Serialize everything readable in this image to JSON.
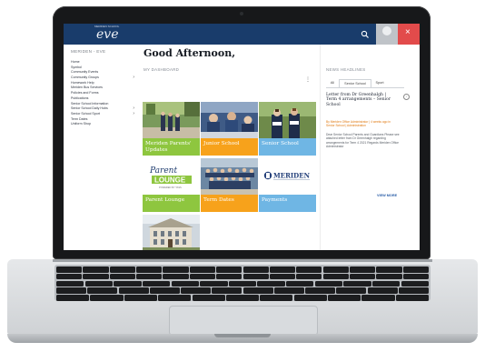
{
  "app": {
    "brand_small": "MERIDEN SCHOOL",
    "brand": "eve",
    "close_label": "×"
  },
  "sidebar": {
    "title": "MERIDEN - EVE",
    "items": [
      {
        "label": "Home",
        "has_submenu": false
      },
      {
        "label": "Symbol",
        "has_submenu": false
      },
      {
        "label": "Community Events",
        "has_submenu": false
      },
      {
        "label": "Community Groups",
        "has_submenu": true
      },
      {
        "label": "Homework Help",
        "has_submenu": false
      },
      {
        "label": "Meriden Bus Services",
        "has_submenu": false
      },
      {
        "label": "Policies and Forms",
        "has_submenu": false
      },
      {
        "label": "Publications",
        "has_submenu": false
      },
      {
        "label": "Senior School Information",
        "has_submenu": false
      },
      {
        "label": "Senior School Daily Hubs",
        "has_submenu": true
      },
      {
        "label": "Senior School Sport",
        "has_submenu": true
      },
      {
        "label": "Term Dates",
        "has_submenu": false
      },
      {
        "label": "Uniform Shop",
        "has_submenu": false
      }
    ],
    "chevron": "›"
  },
  "main": {
    "greeting": "Good Afternoon,",
    "dashboard_label": "MY DASHBOARD",
    "more_label": "⋮",
    "tiles": [
      {
        "label": "Meriden Parents' Updates",
        "bar_color": "#8ec63f",
        "photo": "students-walking"
      },
      {
        "label": "Junior School",
        "bar_color": "#f7a21b",
        "photo": "classroom"
      },
      {
        "label": "Senior School",
        "bar_color": "#6fb6e4",
        "photo": "senior-girls"
      },
      {
        "label": "Parent Lounge",
        "bar_color": "#8ec63f",
        "photo": "parent-lounge-logo",
        "logo_text": "Parent LOUNGE",
        "logo_sub": "POWERED BY TASS"
      },
      {
        "label": "Term Dates",
        "bar_color": "#f7a21b",
        "photo": "group-photo"
      },
      {
        "label": "Payments",
        "bar_color": "#6fb6e4",
        "photo": "meriden-logo",
        "logo_text": "MERIDEN"
      },
      {
        "label": "",
        "bar_color": "#8ec63f",
        "photo": "building"
      }
    ]
  },
  "news": {
    "title": "NEWS HEADLINES",
    "tabs": [
      {
        "label": "All",
        "active": false
      },
      {
        "label": "Senior School",
        "active": true
      },
      {
        "label": "Sport",
        "active": false
      }
    ],
    "article": {
      "title": "Letter from Dr Greenhalgh | Term 4 arrangements – Senior School",
      "meta": "By Meriden Office Administrator | 4 weeks ago in Senior School | Administration",
      "body": "Dear Senior School Parents and Guardians Please see attached letter from Dr Greenhalgh regarding arrangements for Term 4 2021 Regards Meriden Office Administrator"
    },
    "view_more": "VIEW MORE"
  }
}
